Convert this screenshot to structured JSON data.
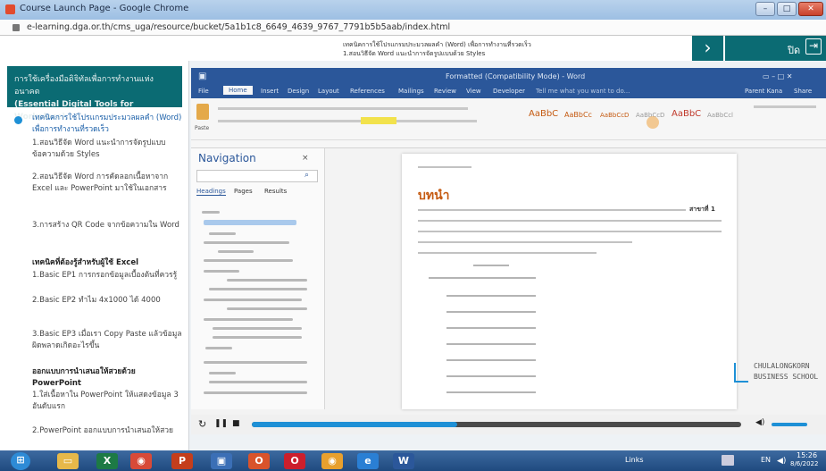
{
  "browser": {
    "window_title": "Course Launch Page - Google Chrome",
    "url": "e-learning.dga.or.th/cms_uga/resource/bucket/5a1b1c8_6649_4639_9767_7791b5b5aab/index.html",
    "controls": {
      "minimize": "–",
      "maximize": "□",
      "close": "✕"
    }
  },
  "course_header": {
    "title_line1": "เทคนิคการใช้โปรแกรมประมวลผลคำ (Word) เพื่อการทำงานที่รวดเร็ว",
    "title_line2": "1.สอนวิธีจัด Word แนะนำการจัดรูปแบบด้วย Styles",
    "next_symbol": "›",
    "exit_label": "ปิด",
    "exit_icon": "⇥"
  },
  "sidebar": {
    "heading_line1": "การใช้เครื่องมือดิจิทัลเพื่อการทำงานแห่งอนาคต",
    "heading_line2": "(Essential Digital Tools for Workplace)",
    "items": [
      {
        "text": "เทคนิคการใช้โปรแกรมประมวลผลคำ (Word) เพื่อการทำงานที่รวดเร็ว",
        "type": "active"
      },
      {
        "text": "1.สอนวิธีจัด Word แนะนำการจัดรูปแบบ ข้อความด้วย Styles",
        "type": "sub"
      },
      {
        "text": "2.สอนวิธีจัด Word การคัดลอกเนื้อหาจาก Excel และ PowerPoint มาใช้ในเอกสาร",
        "type": "sub"
      },
      {
        "text": "3.การสร้าง QR Code จากข้อความใน Word",
        "type": "sub"
      },
      {
        "text": "เทคนิคที่ต้องรู้สำหรับผู้ใช้ Excel",
        "type": "bold"
      },
      {
        "text": "1.Basic EP1 การกรอกข้อมูลเบื้องต้นที่ควรรู้",
        "type": "sub"
      },
      {
        "text": "2.Basic EP2 ทำไม 4x1000 ได้ 4000",
        "type": "sub"
      },
      {
        "text": "3.Basic EP3 เมื่อเรา Copy Paste แล้วข้อมูลผิดพลาดเกิดอะไรขึ้น",
        "type": "sub"
      },
      {
        "text": "ออกแบบการนำเสนอให้สวยด้วย PowerPoint",
        "type": "bold"
      },
      {
        "text": "1.ใส่เนื้อหาใน PowerPoint ให้แสดงข้อมูล 3 อันดับแรก",
        "type": "sub"
      },
      {
        "text": "2.PowerPoint ออกแบบการนำเสนอให้สวย",
        "type": "sub"
      }
    ]
  },
  "word": {
    "title": "Formatted (Compatibility Mode) - Word",
    "user": "Parent Kana",
    "share": "Share",
    "tabs": [
      "File",
      "Home",
      "Insert",
      "Design",
      "Layout",
      "References",
      "Mailings",
      "Review",
      "View",
      "Developer",
      "Tell me what you want to do..."
    ],
    "styles": [
      "AaBbC",
      "AaBbCc",
      "AaBbCcD",
      "AaBbCcD",
      "AaBbC",
      "AaBbCcl"
    ],
    "navigation": {
      "title": "Navigation",
      "close": "×",
      "pin": "▾",
      "search_icon": "⌕",
      "tabs": [
        "Headings",
        "Pages",
        "Results"
      ]
    },
    "page_heading": "บทนำ",
    "paste_label": "Paste",
    "bold_highlight": "สาขาที่ 1"
  },
  "brand": {
    "line1": "CHULALONGKORN",
    "line2": "BUSINESS SCHOOL"
  },
  "player": {
    "restart": "↻",
    "pause": "❚❚",
    "stop": "■",
    "volume": "◀)",
    "progress_fraction": 0.42
  },
  "taskbar": {
    "apps": [
      {
        "name": "start",
        "glyph": "⊞",
        "color": "#2e8bd6"
      },
      {
        "name": "explorer",
        "glyph": "▭",
        "color": "#e6b84a"
      },
      {
        "name": "excel",
        "glyph": "X",
        "color": "#1d7a45"
      },
      {
        "name": "chrome",
        "glyph": "◉",
        "color": "#d84a38"
      },
      {
        "name": "powerpoint-red",
        "glyph": "P",
        "color": "#c43e1c"
      },
      {
        "name": "app-blue",
        "glyph": "▣",
        "color": "#3b6fb6"
      },
      {
        "name": "office",
        "glyph": "O",
        "color": "#d9532b"
      },
      {
        "name": "opera",
        "glyph": "O",
        "color": "#cc1f2c"
      },
      {
        "name": "chrome2",
        "glyph": "◉",
        "color": "#e8a02e"
      },
      {
        "name": "ie",
        "glyph": "e",
        "color": "#2a7fd4"
      },
      {
        "name": "word",
        "glyph": "W",
        "color": "#2b579a"
      }
    ],
    "links_label": "Links",
    "lang": "EN",
    "time": "15:26",
    "date": "8/6/2022"
  }
}
